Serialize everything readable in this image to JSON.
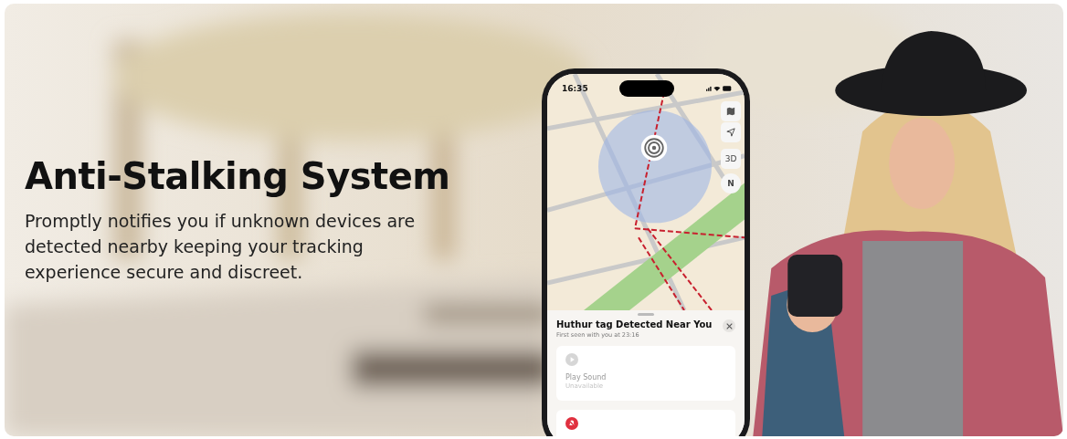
{
  "banner": {
    "title": "Anti-Stalking System",
    "description": "Promptly notifies you if unknown devices are detected nearby keeping your tracking experience secure and discreet."
  },
  "phone": {
    "time": "16:35",
    "map_controls": [
      {
        "kind": "map"
      },
      {
        "kind": "location"
      },
      {
        "kind": "text",
        "label": "3D"
      },
      {
        "kind": "compass",
        "label": "N"
      }
    ],
    "alert": {
      "title": "Huthur tag Detected Near You",
      "subtitle": "First seen with you at 23:16",
      "actions": [
        {
          "kind": "sound",
          "label": "Play Sound",
          "status": "Unavailable",
          "disabled": true
        },
        {
          "kind": "silence"
        }
      ]
    }
  }
}
